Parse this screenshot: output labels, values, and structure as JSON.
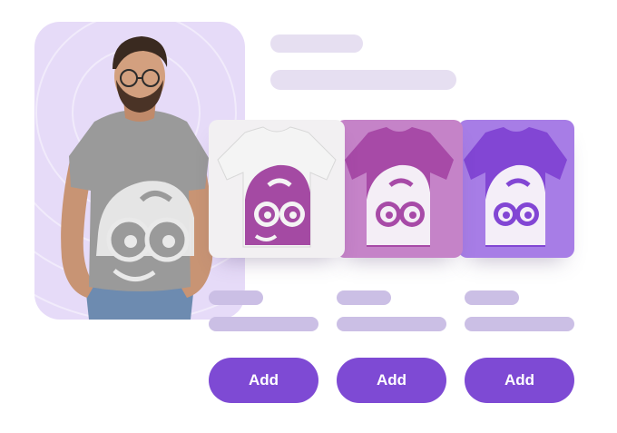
{
  "placeholders": {
    "count": 2
  },
  "products": [
    {
      "color_name": "white",
      "shirt_color": "#f4f4f4",
      "graphic_color": "#a44aa3"
    },
    {
      "color_name": "magenta",
      "shirt_color": "#a74aa7",
      "graphic_color": "#f4eef6"
    },
    {
      "color_name": "violet",
      "shirt_color": "#8246d4",
      "graphic_color": "#f4eef8"
    }
  ],
  "buttons": {
    "add_1": "Add",
    "add_2": "Add",
    "add_3": "Add"
  },
  "colors": {
    "accent": "#7e4ad4",
    "hero_background": "#e6dbf8",
    "skeleton_light": "#e6dff1",
    "skeleton_dark": "#cbbfe5"
  },
  "hero": {
    "shirt_color": "#9a9a9a",
    "graphic_color": "#e9e9e9"
  }
}
